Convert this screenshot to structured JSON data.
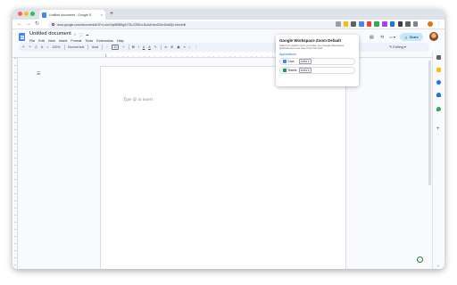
{
  "browser": {
    "tab_title": "Untitled document - Google D",
    "tab_close": "×",
    "new_tab": "+",
    "nav": {
      "back": "←",
      "forward": "→",
      "reload": "↻"
    },
    "url": "docs.google.com/document/d/1FxLnJuGdp9BRBgA7OtLZZflDvLBxAAHwxSZm40ddQh-ktm/edit",
    "menu": "⋮"
  },
  "docs": {
    "title": "Untitled document",
    "title_icons": "☆ ⬚ ☁",
    "menus": [
      "File",
      "Edit",
      "View",
      "Insert",
      "Format",
      "Tools",
      "Extensions",
      "Help"
    ],
    "header_icons": {
      "history": "⟲",
      "comments": "▤",
      "meet": "▭ ▾"
    },
    "share_label": "Share",
    "share_icon": "🔒",
    "editing_label": "✎ Editing  ▾",
    "toolbar": {
      "undo": "↶",
      "redo": "↷",
      "print": "⎙",
      "spellcheck": "A",
      "paint": "⌖",
      "zoom": "100%",
      "style": "Normal text",
      "font": "Arial",
      "minus": "−",
      "size": "11",
      "plus": "+",
      "bold": "B",
      "italic": "I",
      "underline": "U",
      "text_color": "A",
      "highlight": "✎",
      "link": "⊝",
      "comment": "⊞",
      "image": "▣",
      "align": "≡",
      "spacing": "↕",
      "more": "⋮",
      "collapse": "⌃"
    },
    "outline_icon": "☰",
    "placeholder": "Type @ to insert"
  },
  "popup": {
    "title": "Google Workspace Zoom Default",
    "description": "Select the default zoom you'd like your Google Workspace applications to use when they first load.",
    "section": "Applications",
    "apps": [
      {
        "name": "Docs",
        "zoom": "125% ▾",
        "color": "#4285f4"
      },
      {
        "name": "Sheets",
        "zoom": "125% ▾",
        "color": "#0f9d58"
      }
    ]
  },
  "sidepanel": {
    "plus": "+",
    "chevron": "›"
  },
  "colors": {
    "accent": "#1a73e8",
    "share_bg": "#c2e7ff",
    "docs_blue": "#4285f4"
  }
}
